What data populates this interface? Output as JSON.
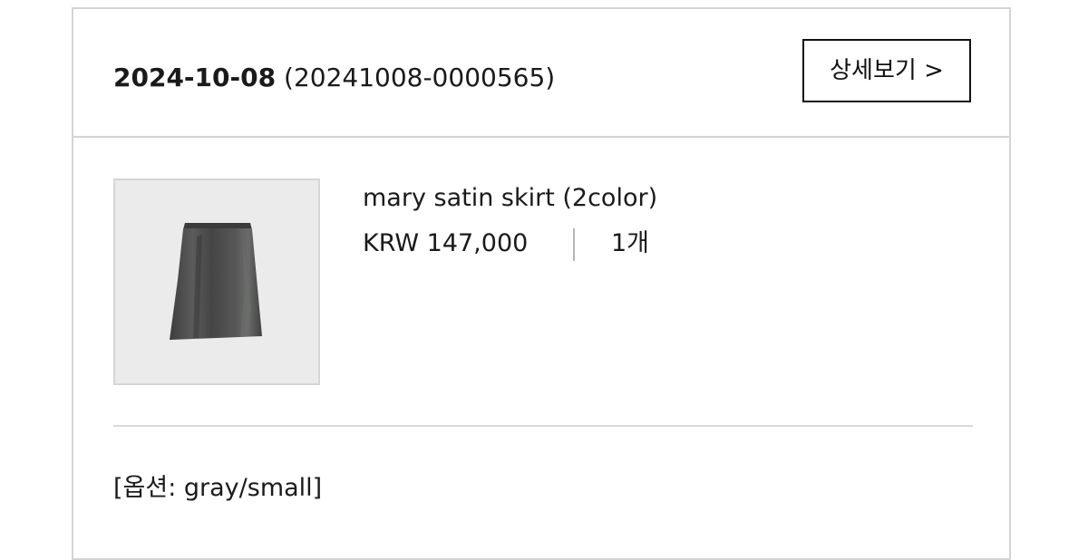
{
  "order": {
    "date": "2024-10-08",
    "number": "(20241008-0000565)",
    "detail_button_label": "상세보기 >"
  },
  "product": {
    "name": "mary satin skirt (2color)",
    "price": "KRW 147,000",
    "quantity": "1개",
    "option": "[옵션: gray/small]",
    "image_icon": "satin-skirt-image"
  },
  "colors": {
    "border": "#d4d4d4",
    "text": "#1a1a1a",
    "thumb_bg": "#ebebeb",
    "skirt": "#4a4b4a"
  }
}
